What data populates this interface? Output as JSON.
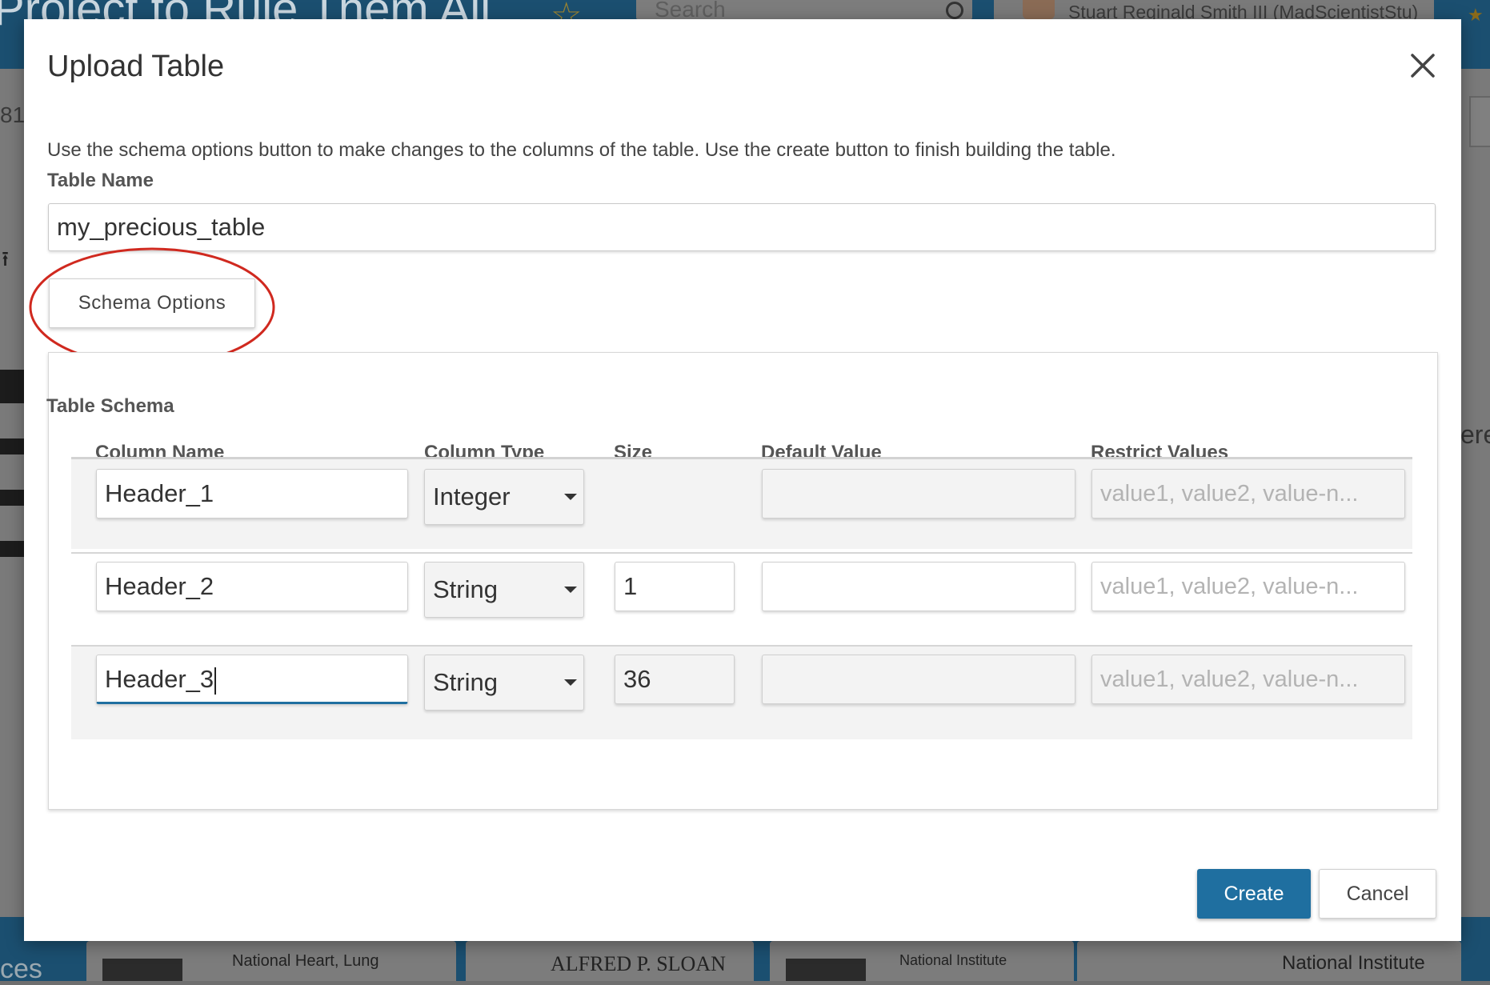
{
  "background": {
    "project_title": "Project to Rule Them All",
    "search_placeholder": "Search",
    "user_name": "Stuart Reginald Smith III (MadScientistStu)",
    "left_fragment": "81",
    "right_fragment": "ere",
    "footer_left_fragment": "ces",
    "logos": [
      "National Heart, Lung",
      "ALFRED P. SLOAN",
      "National Institute",
      "National Institute"
    ]
  },
  "modal": {
    "title": "Upload Table",
    "close_icon": "close-icon",
    "instructions": "Use the schema options button to make changes to the columns of the table. Use the create button to finish building the table.",
    "table_name_label": "Table Name",
    "table_name_value": "my_precious_table",
    "schema_options_label": "Schema Options",
    "annotation_color": "#d0291f",
    "schema": {
      "title": "Table Schema",
      "columns": [
        "Column Name",
        "Column Type",
        "Size",
        "Default Value",
        "Restrict Values"
      ],
      "rows": [
        {
          "name": "Header_1",
          "type": "Integer",
          "size": "",
          "default": "",
          "restrict_placeholder": "value1, value2, value-n..."
        },
        {
          "name": "Header_2",
          "type": "String",
          "size": "1",
          "default": "",
          "restrict_placeholder": "value1, value2, value-n..."
        },
        {
          "name": "Header_3",
          "type": "String",
          "size": "36",
          "default": "",
          "restrict_placeholder": "value1, value2, value-n..."
        }
      ]
    },
    "create_label": "Create",
    "cancel_label": "Cancel",
    "accent_color": "#1f6fa0"
  }
}
